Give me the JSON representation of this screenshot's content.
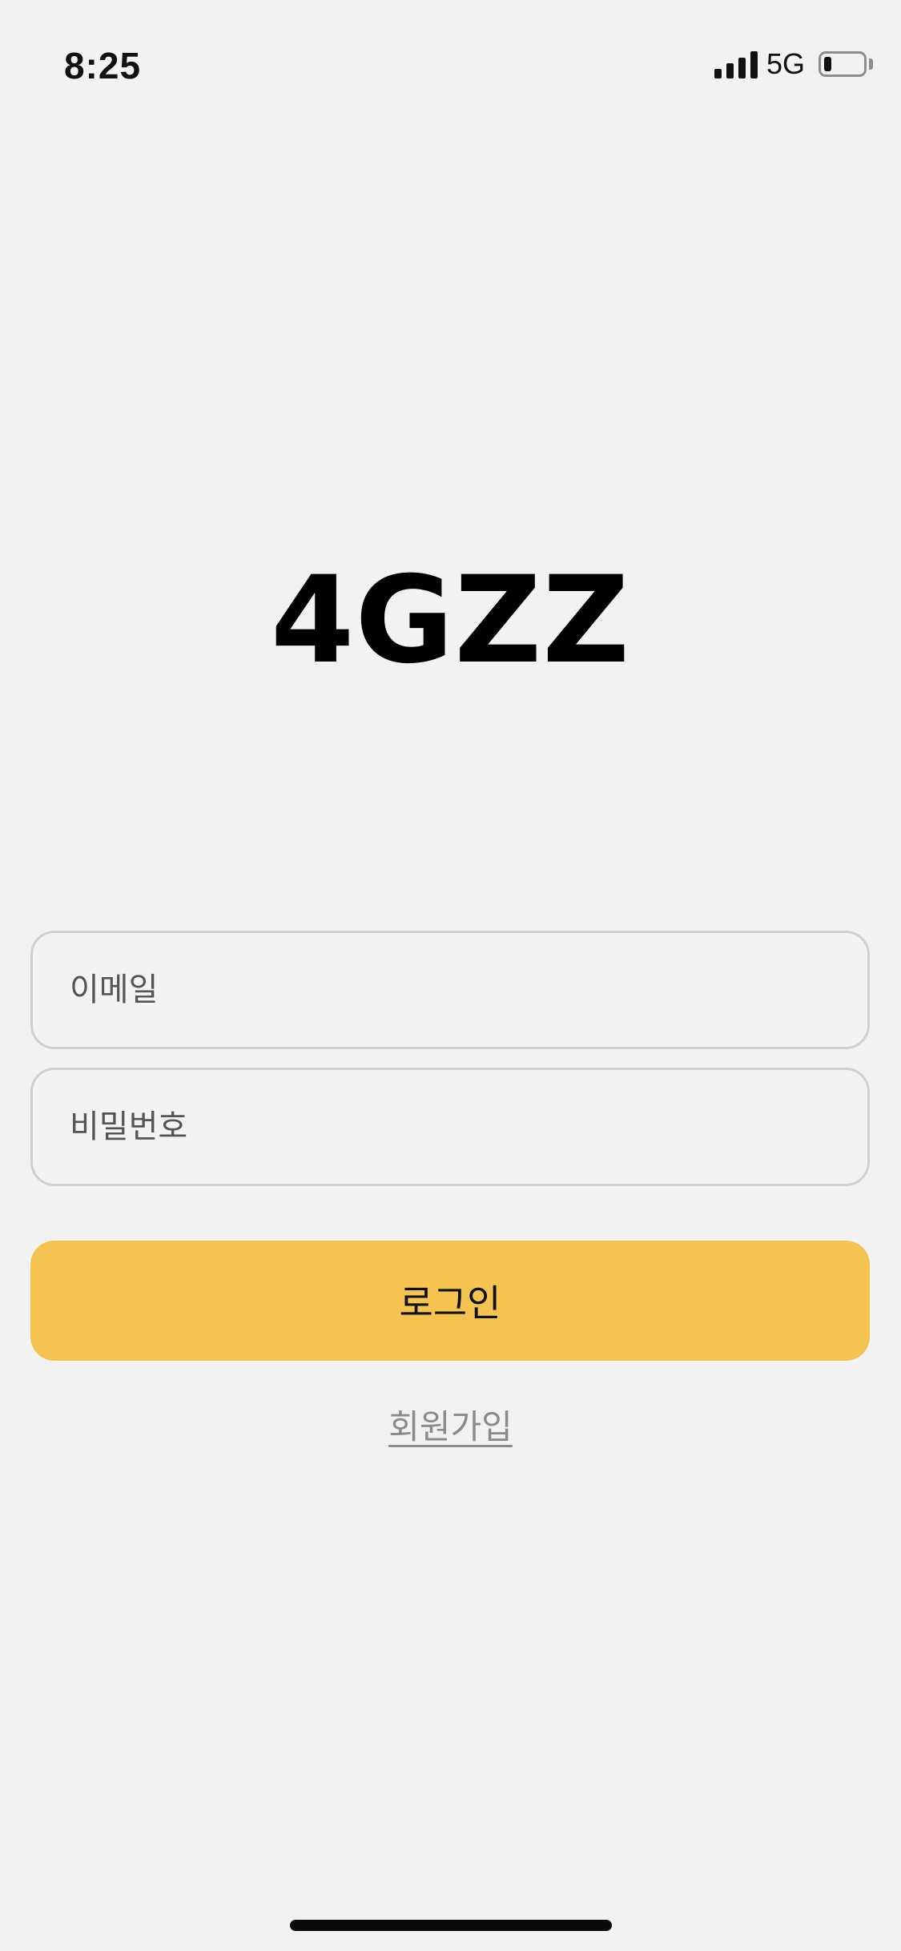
{
  "status_bar": {
    "time": "8:25",
    "network": "5G",
    "signal_bars": 4,
    "battery_level": 0.2
  },
  "logo": {
    "text": "4GZZ"
  },
  "login_form": {
    "email_placeholder": "이메일",
    "password_placeholder": "비밀번호",
    "login_label": "로그인",
    "signup_label": "회원가입"
  },
  "colors": {
    "background": "#f2f2f2",
    "accent": "#f5c34f",
    "field_border": "#d0d0d0",
    "link": "#8a8a8a"
  },
  "icons": {
    "signal": "cellular-signal-icon",
    "battery": "battery-icon"
  }
}
